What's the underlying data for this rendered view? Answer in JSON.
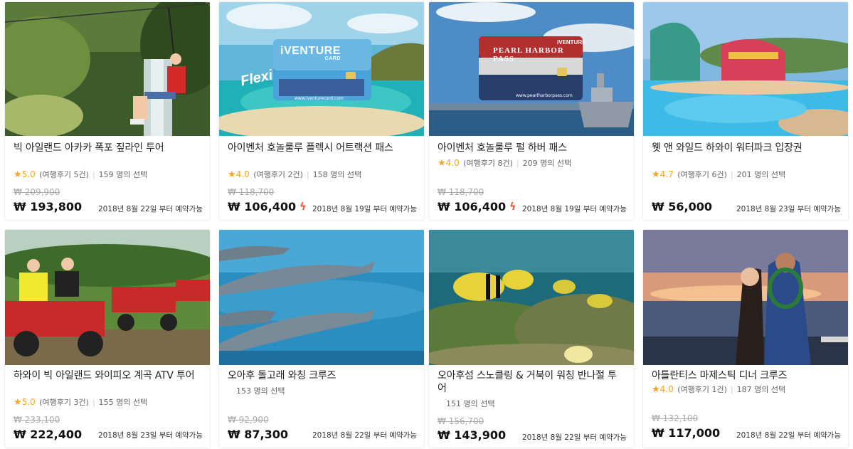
{
  "cards": [
    {
      "title": "빅 아일랜드 아카카 폭포 짚라인 투어",
      "star": "★",
      "rating": "5.0",
      "reviews": "(여행후기 5건)",
      "sep": "|",
      "selections": "159 명의 선택",
      "old_price": "₩ 209,900",
      "price": "₩ 193,800",
      "bolt": "",
      "availability": "2018년 8월 22일 부터 예약가능"
    },
    {
      "title": "아이벤처 호놀룰루 플렉시 어트랙션 패스",
      "star": "★",
      "rating": "4.0",
      "reviews": "(여행후기 2건)",
      "sep": "|",
      "selections": "158 명의 선택",
      "old_price": "₩ 118,700",
      "price": "₩ 106,400",
      "bolt": "ϟ",
      "availability": "2018년 8월 19일 부터 예약가능"
    },
    {
      "title": "아이벤처 호놀룰루 펄 하버 패스",
      "star": "★",
      "rating": "4.0",
      "reviews": "(여행후기 8건)",
      "sep": "|",
      "selections": "209 명의 선택",
      "old_price": "₩ 118,700",
      "price": "₩ 106,400",
      "bolt": "ϟ",
      "availability": "2018년 8월 19일 부터 예약가능"
    },
    {
      "title": "웻 앤 와일드 하와이 워터파크 입장권",
      "star": "★",
      "rating": "4.7",
      "reviews": "(여행후기 6건)",
      "sep": "|",
      "selections": "201 명의 선택",
      "old_price": "",
      "price": "₩ 56,000",
      "bolt": "",
      "availability": "2018년 8월 23일 부터 예약가능"
    },
    {
      "title": "하와이 빅 아일랜드 와이피오 계곡 ATV 투어",
      "star": "★",
      "rating": "5.0",
      "reviews": "(여행후기 3건)",
      "sep": "|",
      "selections": "155 명의 선택",
      "old_price": "₩ 233,100",
      "price": "₩ 222,400",
      "bolt": "",
      "availability": "2018년 8월 23일 부터 예약가능"
    },
    {
      "title": "오아후 돌고래 와칭 크루즈",
      "star": "",
      "rating": "",
      "reviews": "",
      "sep": "",
      "selections": "153 명의 선택",
      "old_price": "₩ 92,900",
      "price": "₩ 87,300",
      "bolt": "",
      "availability": "2018년 8월 22일 부터 예약가능"
    },
    {
      "title": "오아후섬 스노클링 & 거북이 워칭 반나절 투어",
      "star": "",
      "rating": "",
      "reviews": "",
      "sep": "",
      "selections": "151 명의 선택",
      "old_price": "₩ 156,700",
      "price": "₩ 143,900",
      "bolt": "",
      "availability": "2018년 8월 22일 부터 예약가능"
    },
    {
      "title": "아틀란티스 마제스틱 디너 크루즈",
      "star": "★",
      "rating": "4.0",
      "reviews": "(여행후기 1건)",
      "sep": "|",
      "selections": "187 명의 선택",
      "old_price": "₩ 132,100",
      "price": "₩ 117,000",
      "bolt": "",
      "availability": "2018년 8월 22일 부터 예약가능"
    }
  ],
  "badges": {
    "iventure_brand": "iVENTURE",
    "iventure_sub": "CARD",
    "flexi": "Flexi",
    "iventure_url": "www.iventurecard.com",
    "pearl_harbor": "PEARL HARBOR PASS",
    "pearl_brand": "iVENTURE",
    "pearl_url": "www.pearlharborpass.com"
  },
  "colors": {
    "star": "#f5a623",
    "bolt": "#f0553a",
    "price": "#111111",
    "old_price": "#aaaaaa"
  }
}
